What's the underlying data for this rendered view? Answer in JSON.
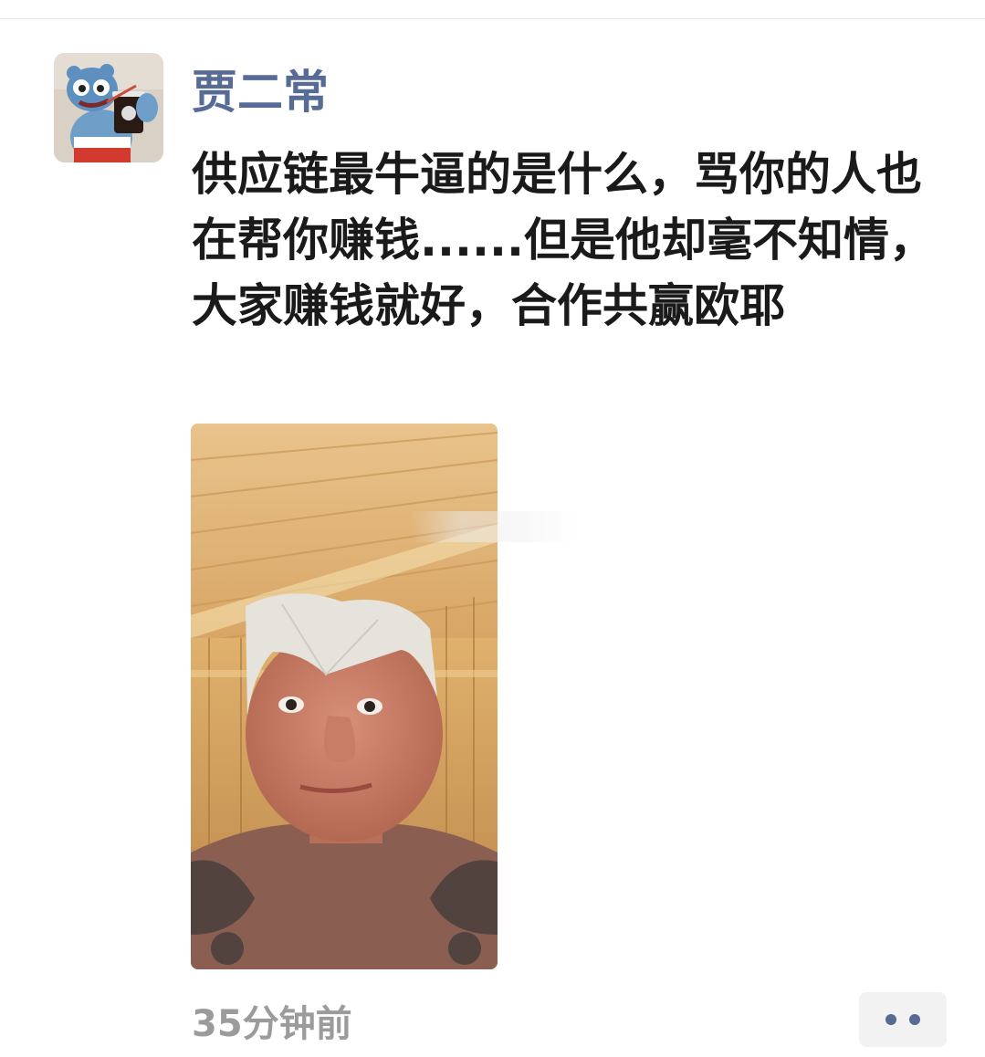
{
  "post": {
    "author": "贾二常",
    "text": "供应链最牛逼的是什么，骂你的人也在帮你赚钱......但是他却毫不知情，大家赚钱就好，合作共赢欧耶",
    "timestamp": "35分钟前"
  },
  "icons": {
    "avatar": "cartoon-mascot-avatar",
    "more": "more-dots-icon"
  },
  "colors": {
    "author_name": "#576b95",
    "body_text": "#1a1a1a",
    "timestamp": "#9b9b9b",
    "more_button_bg": "#f2f2f2"
  }
}
